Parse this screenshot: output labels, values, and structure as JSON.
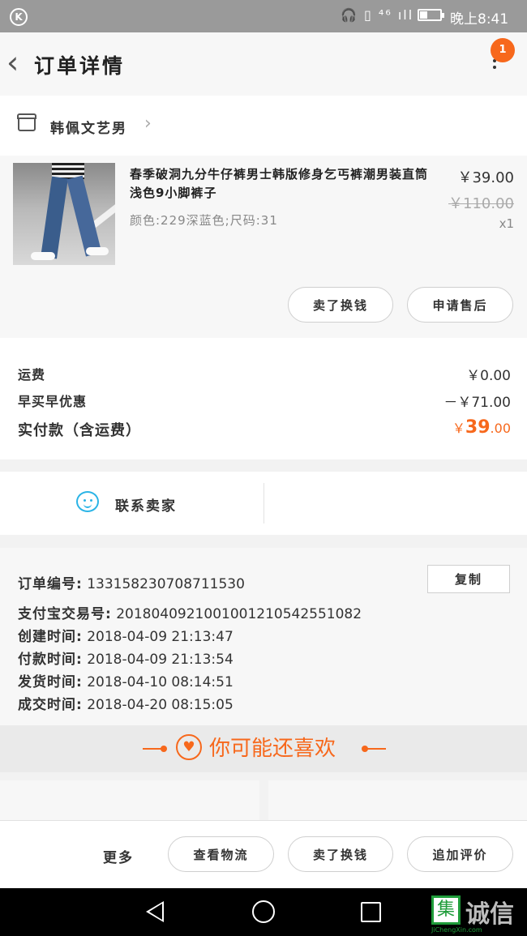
{
  "status_bar": {
    "time": "晚上8:41",
    "left_icon": "K",
    "icons": "🎧 ▯ ⁴⁶ ıll"
  },
  "header": {
    "title": "订单详情",
    "badge_count": "1"
  },
  "shop": {
    "name": "韩佩文艺男"
  },
  "product": {
    "name": "春季破洞九分牛仔裤男士韩版修身乞丐裤潮男装直筒浅色9小脚裤子",
    "spec": "颜色:229深蓝色;尺码:31",
    "price": "￥39.00",
    "original_price": "￥110.00",
    "quantity": "x1",
    "buttons": {
      "buy_again": "卖了换钱",
      "after_sale": "申请售后"
    }
  },
  "fees": {
    "shipping_label": "运费",
    "shipping_value": "￥0.00",
    "discount_label": "早买早优惠",
    "discount_value": "－￥71.00",
    "paid_label": "实付款（含运费）",
    "paid_currency": "￥",
    "paid_int": "39",
    "paid_dec": ".00"
  },
  "contact": {
    "label": "联系卖家"
  },
  "order_info": {
    "copy_label": "复制",
    "rows": [
      {
        "label": "订单编号:",
        "value": "1331582307087115​30"
      },
      {
        "label": "支付宝交易号:",
        "value": "2018040921001001210542551082"
      },
      {
        "label": "创建时间:",
        "value": "2018-04-09 21:13:47"
      },
      {
        "label": "付款时间:",
        "value": "2018-04-09 21:13:54"
      },
      {
        "label": "发货时间:",
        "value": "2018-04-10 08:14:51"
      },
      {
        "label": "成交时间:",
        "value": "2018-04-20 08:15:05"
      }
    ]
  },
  "recommend": {
    "title": "你可能还喜欢"
  },
  "bottom_actions": {
    "more": "更多",
    "view_logistics": "查看物流",
    "resell": "卖了换钱",
    "add_review": "追加评价"
  },
  "watermark": {
    "brand": "诚信",
    "box_char": "集",
    "site": "JiChengXin.com"
  },
  "colors": {
    "accent": "#f7681c",
    "service_blue": "#2bb4e6"
  }
}
